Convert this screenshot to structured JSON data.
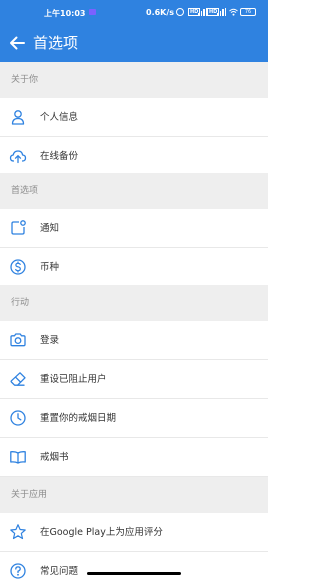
{
  "status_bar": {
    "time": "上午10:03",
    "net_speed": "0.6K/s",
    "signal_tag_1": "HD",
    "signal_tag_2": "HD",
    "battery": "76"
  },
  "app_bar": {
    "title": "首选项",
    "back_icon": "arrow-left-icon"
  },
  "colors": {
    "primary": "#2f82e0",
    "section_bg": "#eeeeee",
    "section_text": "#8c8c8c",
    "icon": "#2f82e0"
  },
  "sections": {
    "about_you": {
      "header": "关于你",
      "items": [
        {
          "label": "个人信息",
          "icon": "person-icon"
        },
        {
          "label": "在线备份",
          "icon": "cloud-upload-icon"
        }
      ]
    },
    "preferences": {
      "header": "首选项",
      "items": [
        {
          "label": "通知",
          "icon": "notification-icon"
        },
        {
          "label": "币种",
          "icon": "currency-icon"
        }
      ]
    },
    "actions": {
      "header": "行动",
      "items": [
        {
          "label": "登录",
          "icon": "camera-icon"
        },
        {
          "label": "重设已阻止用户",
          "icon": "eraser-icon"
        },
        {
          "label": "重置你的戒烟日期",
          "icon": "clock-icon"
        },
        {
          "label": "戒烟书",
          "icon": "book-icon"
        }
      ]
    },
    "about_app": {
      "header": "关于应用",
      "items": [
        {
          "label": "在Google Play上为应用评分",
          "icon": "star-icon"
        },
        {
          "label": "常见问题",
          "icon": "help-icon"
        }
      ]
    }
  }
}
